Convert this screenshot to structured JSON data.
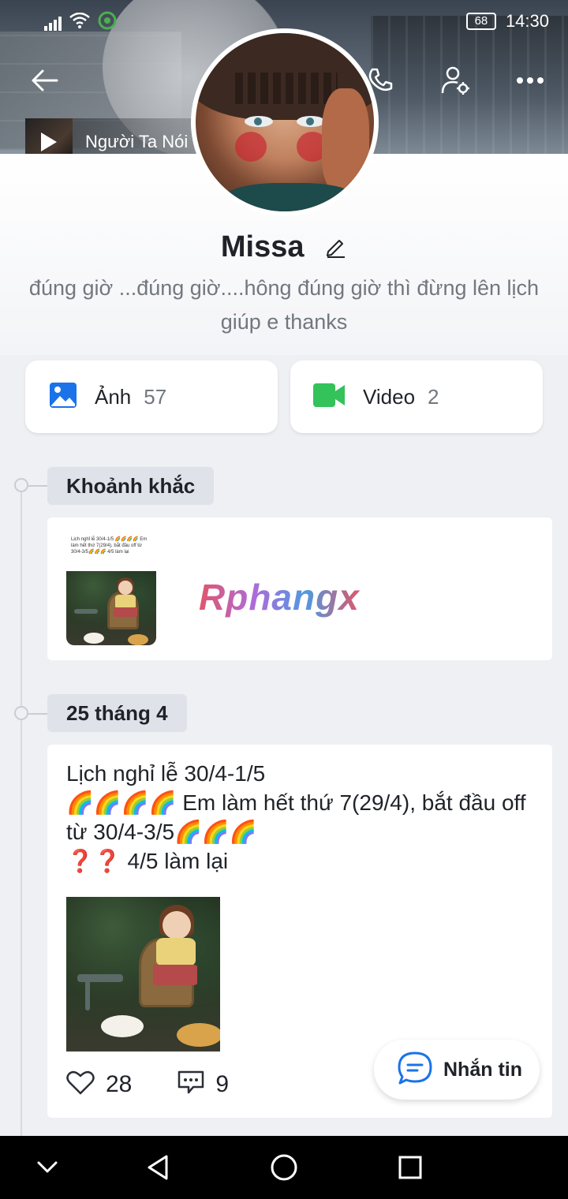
{
  "status_bar": {
    "battery": "68",
    "time": "14:30",
    "icons": [
      "signal-icon",
      "wifi-icon",
      "app-notification-icon"
    ]
  },
  "top_bar": {
    "icons": [
      "back-arrow-icon",
      "phone-icon",
      "user-settings-icon",
      "more-dots-icon"
    ]
  },
  "music": {
    "title": "Người Ta Nói"
  },
  "profile": {
    "name": "Missa",
    "bio": "đúng giờ ...đúng giờ....hông đúng giờ thì đừng lên lịch giúp e thanks"
  },
  "media": [
    {
      "label": "Ảnh",
      "count": "57",
      "icon": "photo-icon",
      "color": "#1a73e8"
    },
    {
      "label": "Video",
      "count": "2",
      "icon": "video-icon",
      "color": "#34c25b"
    }
  ],
  "sections": {
    "moments": {
      "title": "Khoảnh khắc",
      "thumb_caption": "Lịch nghỉ lễ 30/4-1/5 🌈🌈🌈🌈 Em làm hết thứ 7(29/4), bắt đầu off từ 30/4-3/5🌈🌈🌈 4/5 làm lại"
    },
    "date": {
      "title": "25 tháng 4"
    }
  },
  "watermark": "Rphangx",
  "post": {
    "text": "Lịch nghỉ lễ 30/4-1/5\n🌈🌈🌈🌈 Em làm hết thứ 7(29/4), bắt đầu off từ  30/4-3/5🌈🌈🌈\n❓❓ 4/5 làm lại",
    "likes": "28",
    "comments": "9"
  },
  "fab": {
    "label": "Nhắn tin"
  },
  "navbar": {
    "icons": [
      "chevron-down-icon",
      "back-triangle-icon",
      "home-circle-icon",
      "recents-square-icon"
    ]
  }
}
